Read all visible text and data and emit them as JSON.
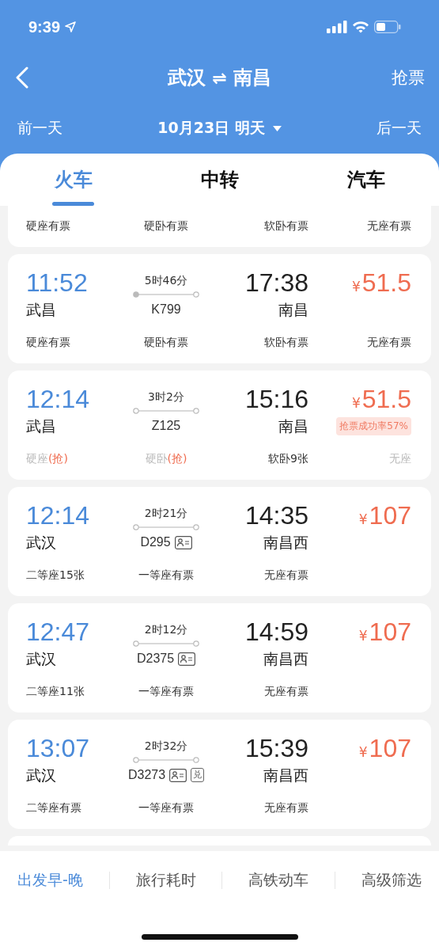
{
  "status_bar": {
    "time": "9:39"
  },
  "header": {
    "from": "武汉",
    "swap": "⇌",
    "to": "南昌",
    "action": "抢票"
  },
  "date_bar": {
    "prev": "前一天",
    "date": "10月23日 明天",
    "next": "后一天"
  },
  "tabs": [
    {
      "label": "火车",
      "selected": true
    },
    {
      "label": "中转",
      "selected": false
    },
    {
      "label": "汽车",
      "selected": false
    }
  ],
  "cut_off_card": {
    "seats": [
      {
        "label": "硬座有票",
        "kind": "available"
      },
      {
        "label": "硬卧有票",
        "kind": "available"
      },
      {
        "label": "软卧有票",
        "kind": "available"
      },
      {
        "label": "无座有票",
        "kind": "available"
      }
    ]
  },
  "trains": [
    {
      "depart": "11:52",
      "from": "武昌",
      "duration": "5时46分",
      "number": "K799",
      "origin_start": true,
      "id_card": false,
      "arrive": "17:38",
      "to": "南昌",
      "currency": "¥",
      "price": "51.5",
      "seats": [
        {
          "label": "硬座有票",
          "kind": "available"
        },
        {
          "label": "硬卧有票",
          "kind": "available"
        },
        {
          "label": "软卧有票",
          "kind": "available"
        },
        {
          "label": "无座有票",
          "kind": "available"
        }
      ]
    },
    {
      "depart": "12:14",
      "from": "武昌",
      "duration": "3时2分",
      "number": "Z125",
      "origin_start": false,
      "id_card": false,
      "arrive": "15:16",
      "to": "南昌",
      "currency": "¥",
      "price": "51.5",
      "note": "抢票成功率57%",
      "seats": [
        {
          "label": "硬座",
          "kind": "grab",
          "tag": "(抢)"
        },
        {
          "label": "硬卧",
          "kind": "grab",
          "tag": "(抢)"
        },
        {
          "label": "软卧9张",
          "kind": "available"
        },
        {
          "label": "无座",
          "kind": "none"
        }
      ]
    },
    {
      "depart": "12:14",
      "from": "武汉",
      "duration": "2时21分",
      "number": "D295",
      "origin_start": false,
      "id_card": true,
      "arrive": "14:35",
      "to": "南昌西",
      "currency": "¥",
      "price": "107",
      "seats": [
        {
          "label": "二等座15张",
          "kind": "available"
        },
        {
          "label": "一等座有票",
          "kind": "available"
        },
        {
          "label": "无座有票",
          "kind": "available"
        }
      ]
    },
    {
      "depart": "12:47",
      "from": "武汉",
      "duration": "2时12分",
      "number": "D2375",
      "origin_start": false,
      "id_card": true,
      "arrive": "14:59",
      "to": "南昌西",
      "currency": "¥",
      "price": "107",
      "seats": [
        {
          "label": "二等座11张",
          "kind": "available"
        },
        {
          "label": "一等座有票",
          "kind": "available"
        },
        {
          "label": "无座有票",
          "kind": "available"
        }
      ]
    },
    {
      "depart": "13:07",
      "from": "武汉",
      "duration": "2时32分",
      "number": "D3273",
      "origin_start": false,
      "id_card": true,
      "tags": [
        "兑"
      ],
      "arrive": "15:39",
      "to": "南昌西",
      "currency": "¥",
      "price": "107",
      "seats": [
        {
          "label": "二等座有票",
          "kind": "available"
        },
        {
          "label": "一等座有票",
          "kind": "available"
        },
        {
          "label": "无座有票",
          "kind": "available"
        }
      ]
    }
  ],
  "filters": [
    {
      "label": "出发早-晚",
      "selected": true
    },
    {
      "label": "旅行耗时",
      "selected": false
    },
    {
      "label": "高铁动车",
      "selected": false
    },
    {
      "label": "高级筛选",
      "selected": false
    }
  ]
}
